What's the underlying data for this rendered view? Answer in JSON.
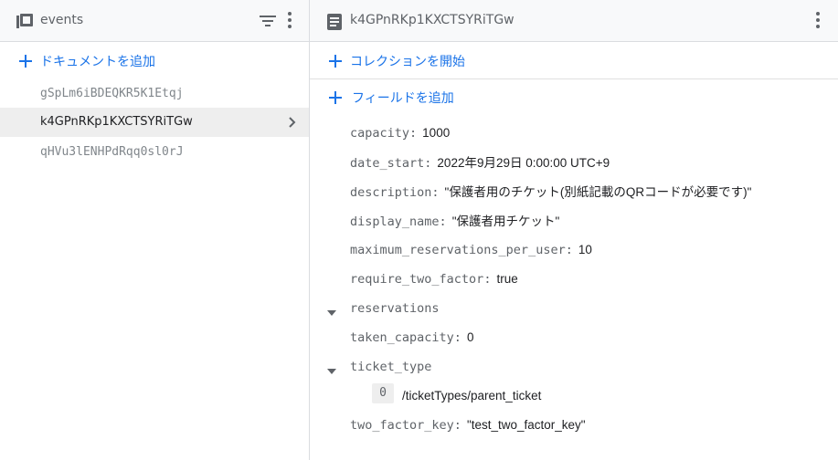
{
  "collection_panel": {
    "title": "events",
    "icon": "collection-icon",
    "add_document_label": "ドキュメントを追加",
    "documents": [
      {
        "id": "gSpLm6iBDEQKR5K1Etqj",
        "selected": false
      },
      {
        "id": "k4GPnRKp1KXCTSYRiTGw",
        "selected": true
      },
      {
        "id": "qHVu3lENHPdRqq0sl0rJ",
        "selected": false
      }
    ]
  },
  "document_panel": {
    "title": "k4GPnRKp1KXCTSYRiTGw",
    "icon": "document-icon",
    "start_collection_label": "コレクションを開始",
    "add_field_label": "フィールドを追加",
    "fields": {
      "capacity": {
        "key": "capacity",
        "value": "1000"
      },
      "date_start": {
        "key": "date_start",
        "value": "2022年9月29日 0:00:00 UTC+9"
      },
      "description": {
        "key": "description",
        "value": "\"保護者用のチケット(別紙記載のQRコードが必要です)\""
      },
      "display_name": {
        "key": "display_name",
        "value": "\"保護者用チケット\""
      },
      "maximum_reservations_per_user": {
        "key": "maximum_reservations_per_user",
        "value": "10"
      },
      "require_two_factor": {
        "key": "require_two_factor",
        "value": "true"
      },
      "reservations": {
        "key": "reservations"
      },
      "taken_capacity": {
        "key": "taken_capacity",
        "value": "0"
      },
      "ticket_type": {
        "key": "ticket_type",
        "items": [
          {
            "index": "0",
            "value": "/ticketTypes/parent_ticket"
          }
        ]
      },
      "two_factor_key": {
        "key": "two_factor_key",
        "value": "\"test_two_factor_key\""
      }
    }
  },
  "colors": {
    "accent": "#1a73e8",
    "header_bg": "#f8f9fa",
    "selected_bg": "#eeeeee",
    "border": "#dadce0"
  }
}
